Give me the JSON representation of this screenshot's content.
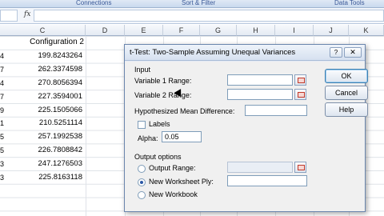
{
  "ribbon": {
    "groups": [
      "Connections",
      "Sort & Filter",
      "Data Tools"
    ]
  },
  "formula_bar": {
    "fx_label": "fx",
    "value": ""
  },
  "columns": [
    "C",
    "D",
    "E",
    "F",
    "G",
    "H",
    "I",
    "J",
    "K"
  ],
  "sheet": {
    "header": "Configuration 2",
    "row_prefix": [
      "4",
      "7",
      "4",
      "7",
      "9",
      "1",
      "5",
      "5",
      "3",
      "3"
    ],
    "values": [
      "199.8243264",
      "262.3374598",
      "270.8056394",
      "227.3594001",
      "225.1505066",
      "210.5251114",
      "257.1992538",
      "226.7808842",
      "247.1276503",
      "225.8163118"
    ]
  },
  "dialog": {
    "title": "t-Test: Two-Sample Assuming Unequal Variances",
    "title_help": "?",
    "title_close": "✕",
    "input_section": "Input",
    "var1_label": "Variable 1 Range:",
    "var1_value": "",
    "var2_label": "Variable 2 Range:",
    "var2_value": "",
    "hyp_label": "Hypothesized Mean Difference:",
    "hyp_value": "",
    "labels_label": "Labels",
    "labels_checked": false,
    "alpha_label": "Alpha:",
    "alpha_value": "0.05",
    "output_section": "Output options",
    "output_range_label": "Output Range:",
    "output_range_value": "",
    "new_ply_label": "New Worksheet Ply:",
    "new_ply_value": "",
    "new_workbook_label": "New Workbook",
    "selected_output": "new_worksheet_ply",
    "ok_label": "OK",
    "cancel_label": "Cancel",
    "help_label": "Help"
  }
}
